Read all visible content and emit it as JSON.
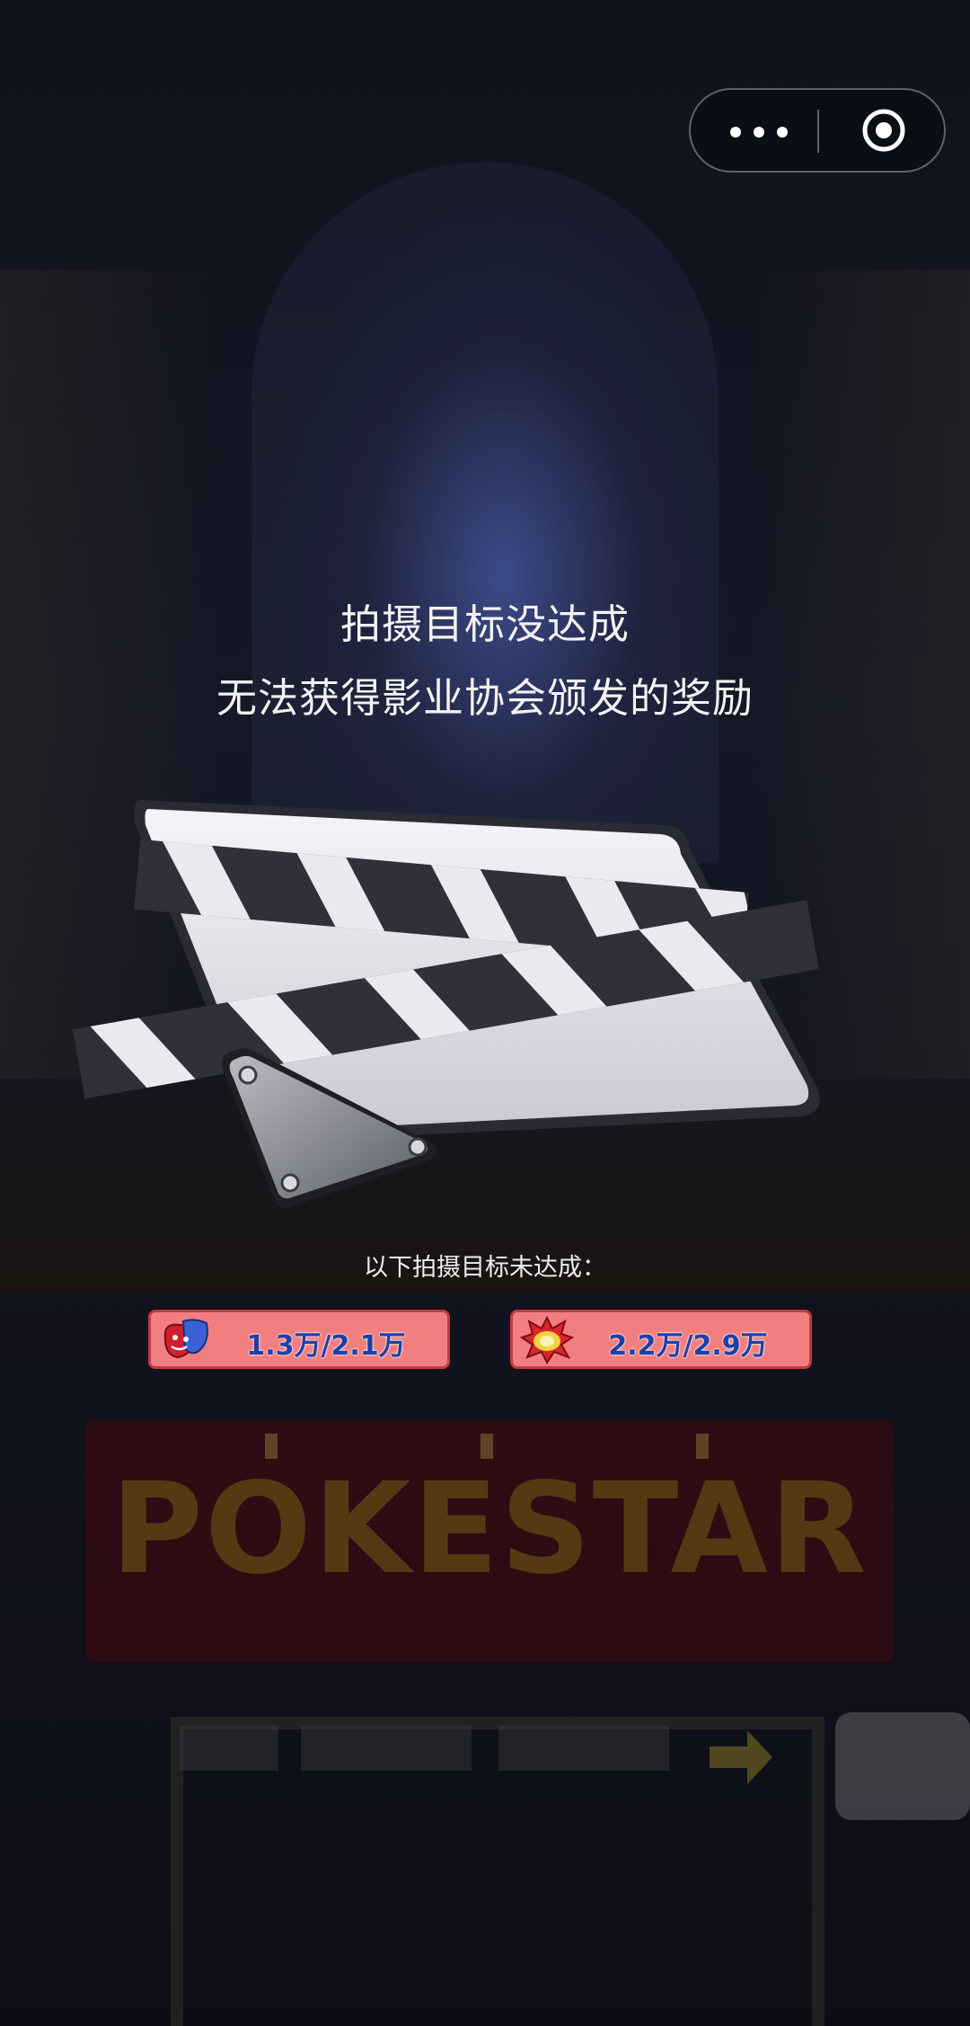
{
  "header": {
    "more_icon": "more-dots-icon",
    "close_icon": "target-close-icon"
  },
  "result": {
    "title_line1": "拍摄目标没达成",
    "title_line2": "无法获得影业协会颁发的奖励",
    "subtitle": "以下拍摄目标未达成：",
    "targets": [
      {
        "icon": "theater-mask-icon",
        "value": "1.3万/2.1万"
      },
      {
        "icon": "explosion-icon",
        "value": "2.2万/2.9万"
      }
    ]
  },
  "background": {
    "sign_text": "POKESTAR"
  },
  "colors": {
    "pill_fill": "#f27f7f",
    "pill_border": "#c23a3f",
    "value_text": "#1e3fa8"
  }
}
